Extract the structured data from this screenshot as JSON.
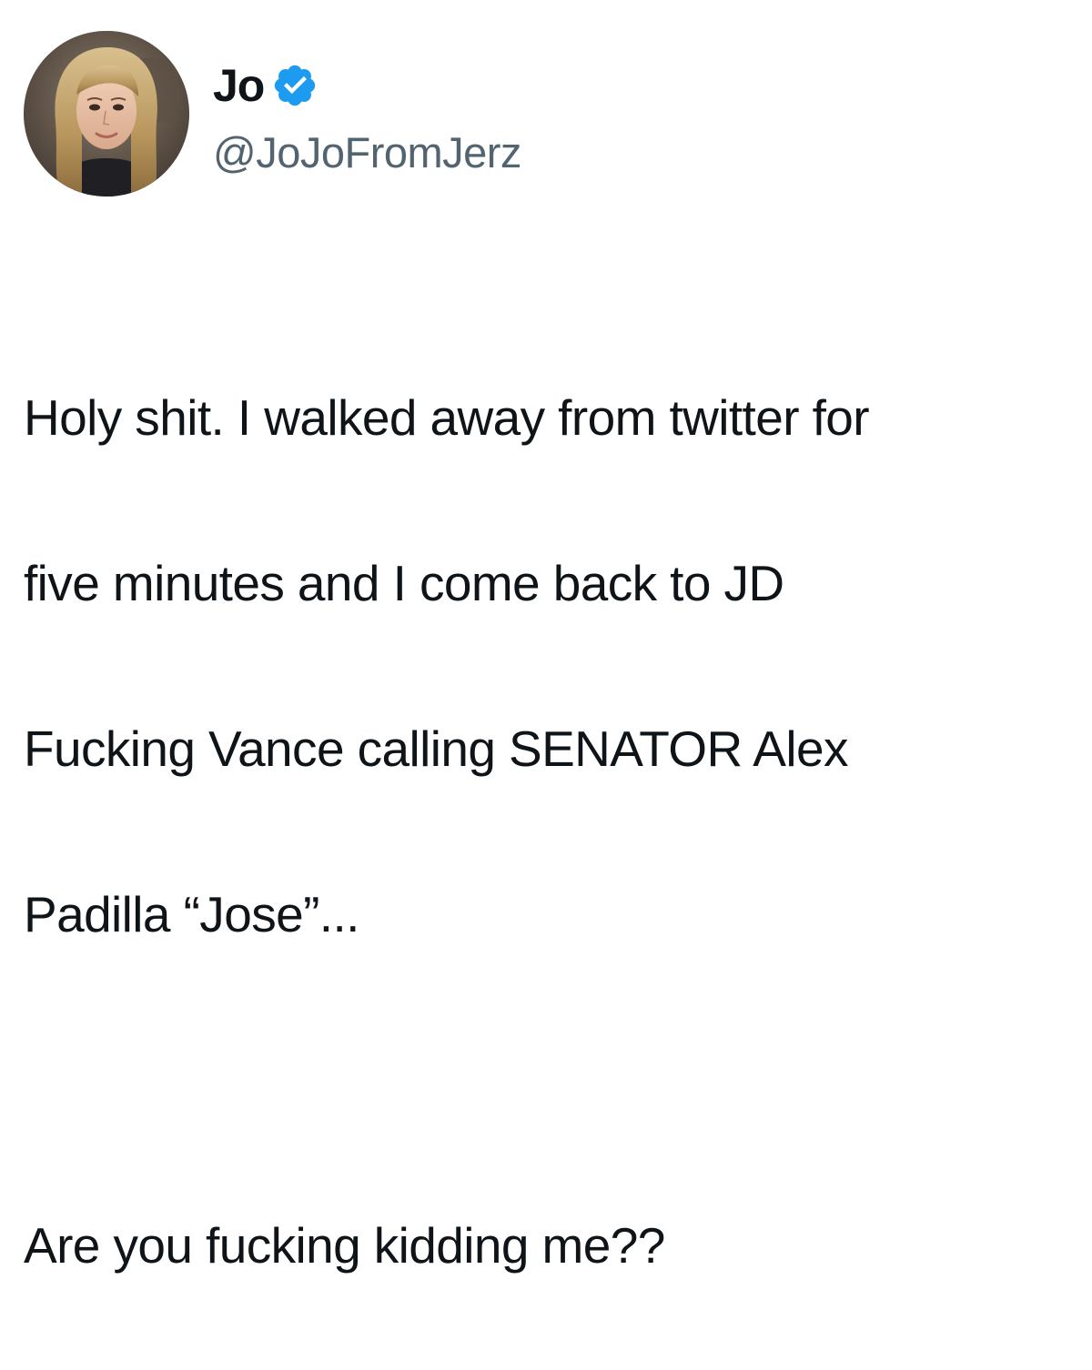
{
  "author": {
    "display_name": "Jo",
    "handle": "@JoJoFromJerz",
    "verified_badge_icon": "verified-check-icon",
    "verified_color": "#1d9bf0"
  },
  "tweet": {
    "lines": [
      "Holy shit. I walked away from twitter for",
      "five minutes and I come back to JD",
      "Fucking Vance calling SENATOR Alex",
      "Padilla “Jose”...",
      "Are you fucking kidding me??"
    ]
  },
  "colors": {
    "text": "#0f1419",
    "secondary_text": "#536471",
    "background": "#ffffff"
  }
}
